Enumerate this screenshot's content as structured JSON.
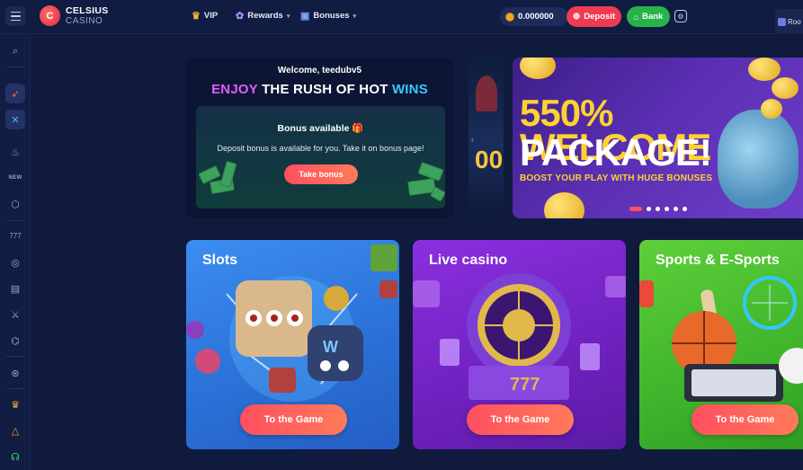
{
  "header": {
    "logo_line1": "CELSIUS",
    "logo_line2": "CASINO",
    "logo_mark": "C",
    "nav": [
      {
        "label": "VIP",
        "icon": "crown-icon"
      },
      {
        "label": "Rewards",
        "icon": "gift-icon"
      },
      {
        "label": "Bonuses",
        "icon": "bonus-icon"
      }
    ],
    "balance": "0.000000",
    "deposit_label": "Deposit",
    "bank_label": "Bank",
    "room_label": "Roo"
  },
  "sidebar": {
    "new_label": "NEW"
  },
  "welcome": {
    "greeting": "Welcome, teedubv5",
    "headline_enjoy": "ENJOY",
    "headline_mid": "THE RUSH OF HOT",
    "headline_wins": "WINS",
    "bonus_title": "Bonus available 🎁",
    "bonus_text": "Deposit bonus is available for you. Take it on bonus page!",
    "take_bonus_label": "Take bonus"
  },
  "carousel": {
    "prev_slide_text": "00",
    "banner_line1": "550% WELCOME",
    "banner_line2": "PACKAGE!",
    "banner_sub": "BOOST YOUR PLAY WITH HUGE BONUSES",
    "slide_count": 6,
    "active_slide": 1
  },
  "categories": [
    {
      "title": "Slots",
      "button": "To the Game"
    },
    {
      "title": "Live casino",
      "button": "To the Game"
    },
    {
      "title": "Sports & E-Sports",
      "button": "To the Game"
    }
  ],
  "colors": {
    "background": "#0f1a3d",
    "accent_red": "#ee3b4f",
    "bank_green": "#27b34a",
    "headline_pink": "#e35bff",
    "headline_blue": "#38c8ff",
    "banner_yellow": "#ffd231"
  }
}
